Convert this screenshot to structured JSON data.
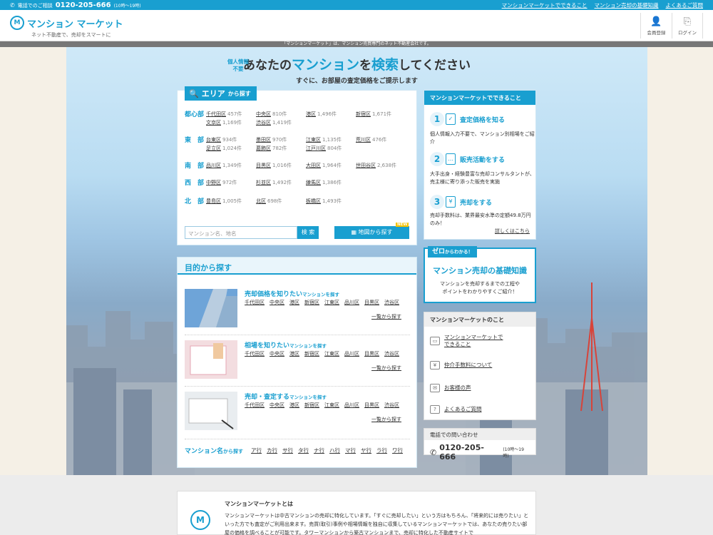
{
  "topbar": {
    "phone_label": "電話でのご相談",
    "phone_number": "0120-205-666",
    "phone_hours": "(10時～19時)",
    "links": [
      "マンションマーケットでできること",
      "マンション売却の基礎知識",
      "よくあるご質問"
    ]
  },
  "header": {
    "logo_text": "マンション マーケット",
    "logo_mark": "M",
    "tagline": "ネット不動産で、売却をスマートに",
    "register_label": "会員登録",
    "login_label": "ログイン"
  },
  "notice": "「マンションマーケット」は、マンション売買専門のネット不動産会社です。",
  "hero": {
    "privacy_line1": "個人情報",
    "privacy_line2": "不要",
    "title_pre": "あなたの",
    "title_hl1": "マンション",
    "title_mid": "を",
    "title_hl2": "検索",
    "title_post": "してください",
    "subtitle": "すぐに、お部屋の査定価格をご提示します"
  },
  "area_search": {
    "tab_title": "エリア",
    "tab_suffix": "から探す",
    "regions": [
      {
        "name": "都心部",
        "wards": [
          {
            "name": "千代田区",
            "count": "457件"
          },
          {
            "name": "中央区",
            "count": "810件"
          },
          {
            "name": "港区",
            "count": "1,496件"
          },
          {
            "name": "新宿区",
            "count": "1,671件"
          },
          {
            "name": "文京区",
            "count": "1,169件"
          },
          {
            "name": "渋谷区",
            "count": "1,419件"
          }
        ]
      },
      {
        "name": "東　部",
        "wards": [
          {
            "name": "台東区",
            "count": "934件"
          },
          {
            "name": "墨田区",
            "count": "970件"
          },
          {
            "name": "江東区",
            "count": "1,135件"
          },
          {
            "name": "荒川区",
            "count": "476件"
          },
          {
            "name": "足立区",
            "count": "1,024件"
          },
          {
            "name": "葛飾区",
            "count": "782件"
          },
          {
            "name": "江戸川区",
            "count": "804件"
          }
        ]
      },
      {
        "name": "南　部",
        "wards": [
          {
            "name": "品川区",
            "count": "1,349件"
          },
          {
            "name": "目黒区",
            "count": "1,016件"
          },
          {
            "name": "大田区",
            "count": "1,964件"
          },
          {
            "name": "世田谷区",
            "count": "2,638件"
          }
        ]
      },
      {
        "name": "西　部",
        "wards": [
          {
            "name": "中野区",
            "count": "972件"
          },
          {
            "name": "杉並区",
            "count": "1,492件"
          },
          {
            "name": "練馬区",
            "count": "1,386件"
          }
        ]
      },
      {
        "name": "北　部",
        "wards": [
          {
            "name": "豊島区",
            "count": "1,005件"
          },
          {
            "name": "北区",
            "count": "698件"
          },
          {
            "name": "板橋区",
            "count": "1,493件"
          }
        ]
      }
    ],
    "search_placeholder": "マンション名、地名",
    "search_button": "検 索",
    "map_button": "地図から探す",
    "new_badge": "NEW"
  },
  "purpose": {
    "heading": "目的から探す",
    "items": [
      {
        "title": "売却価格を知りたい",
        "title_suffix": "マンションを探す",
        "more": "一覧から探す"
      },
      {
        "title": "相場を知りたい",
        "title_suffix": "マンションを探す",
        "more": "一覧から探す"
      },
      {
        "title": "売却・査定する",
        "title_suffix": "マンションを探す",
        "more": "一覧から探す"
      }
    ],
    "wards": [
      "千代田区",
      "中央区",
      "港区",
      "新宿区",
      "江東区",
      "品川区",
      "目黒区",
      "渋谷区"
    ],
    "kana_label": "マンション名",
    "kana_suffix": "から探す",
    "kana": [
      "ア行",
      "カ行",
      "サ行",
      "タ行",
      "ナ行",
      "ハ行",
      "マ行",
      "ヤ行",
      "ラ行",
      "ワ行"
    ]
  },
  "can_do": {
    "heading": "マンションマーケットでできること",
    "steps": [
      {
        "num": "1",
        "title": "査定価格を知る",
        "desc": "個人情報入力不要で、マンション別相場をご紹介"
      },
      {
        "num": "2",
        "title": "販売活動をする",
        "desc": "大手出身・経験豊富な売却コンサルタントが、売主様に寄り添った販売を実施"
      },
      {
        "num": "3",
        "title": "売却をする",
        "desc": "売却手数料は、業界最安水準の定額49.8万円のみ！"
      }
    ],
    "details_link": "詳しくはこちら"
  },
  "zero_banner": {
    "tag_main": "ゼロ",
    "tag_suffix": "からわかる！",
    "title": "マンション売却の基礎知識",
    "desc_line1": "マンションを売却するまでの工程や",
    "desc_line2": "ポイントをわかりやすくご紹介！"
  },
  "about_list": {
    "heading": "マンションマーケットのこと",
    "items": [
      {
        "label1": "マンションマーケットで",
        "label2": "できること"
      },
      {
        "label1": "仲介手数料について",
        "label2": ""
      },
      {
        "label1": "お客様の声",
        "label2": ""
      },
      {
        "label1": "よくあるご質問",
        "label2": ""
      }
    ]
  },
  "phone_box": {
    "heading": "電話での問い合わせ",
    "number": "0120-205-666",
    "hours": "(10時～19時)"
  },
  "about_card": {
    "title": "マンションマーケットとは",
    "body": "マンションマーケットは中古マンションの売却に特化しています。「すぐに売却したい」という方はもちろん、「将来的には売りたい」といった方でも査定がご利用出来ます。売買(取引)事例や相場情報を独自に収集しているマンションマーケットでは、あなたの売りたい部屋の価格を調べることが可能です。タワーマンションから築古マンションまで、売却に特化した不動産サイトで"
  },
  "colors": {
    "accent": "#199fd0",
    "notice_bg": "#777777",
    "new_badge": "#f6c300"
  }
}
